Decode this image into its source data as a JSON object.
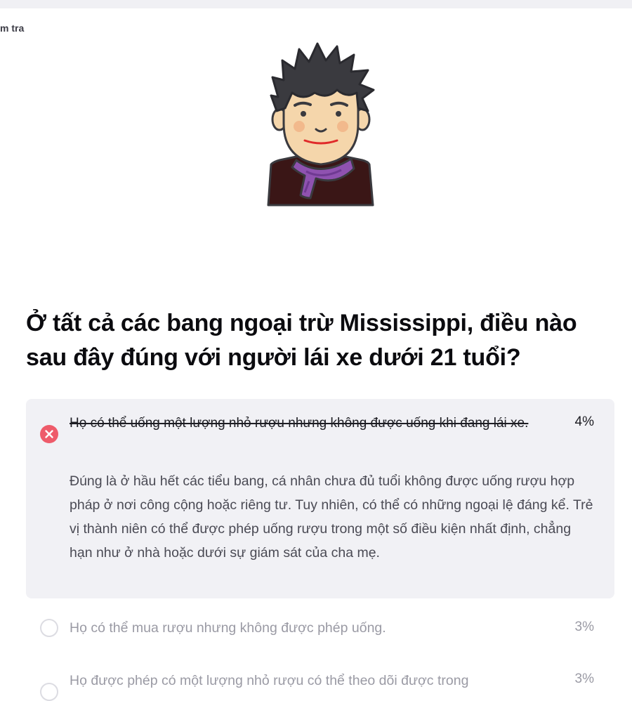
{
  "breadcrumb": "m tra",
  "question": "Ở tất cả các bang ngoại trừ Mississippi, điều nào sau đây đúng với người lái xe dưới 21 tuổi?",
  "selected_answer": {
    "text": "Họ có thể uống một lượng nhỏ rượu nhưng không được uống khi đang lái xe.",
    "percent": "4%",
    "status": "incorrect",
    "explanation": "Đúng là ở hầu hết các tiểu bang, cá nhân chưa đủ tuổi không được uống rượu hợp pháp ở nơi công cộng hoặc riêng tư. Tuy nhiên, có thể có những ngoại lệ đáng kể. Trẻ vị thành niên có thể được phép uống rượu trong một số điều kiện nhất định, chẳng hạn như ở nhà hoặc dưới sự giám sát của cha mẹ."
  },
  "options": [
    {
      "text": "Họ có thể mua rượu nhưng không được phép uống.",
      "percent": "3%"
    },
    {
      "text": "Họ được phép có một lượng nhỏ rượu có thể theo dõi được trong",
      "percent": "3%"
    }
  ],
  "icons": {
    "wrong": "x-circle-icon",
    "radio": "radio-empty-icon"
  },
  "colors": {
    "incorrect": "#ee5b6a",
    "card_bg": "#f1f1f5",
    "muted_text": "#9a9aa4",
    "scarf": "#8f52b0",
    "hair": "#3a3a3f",
    "skin": "#f5d6ab"
  }
}
